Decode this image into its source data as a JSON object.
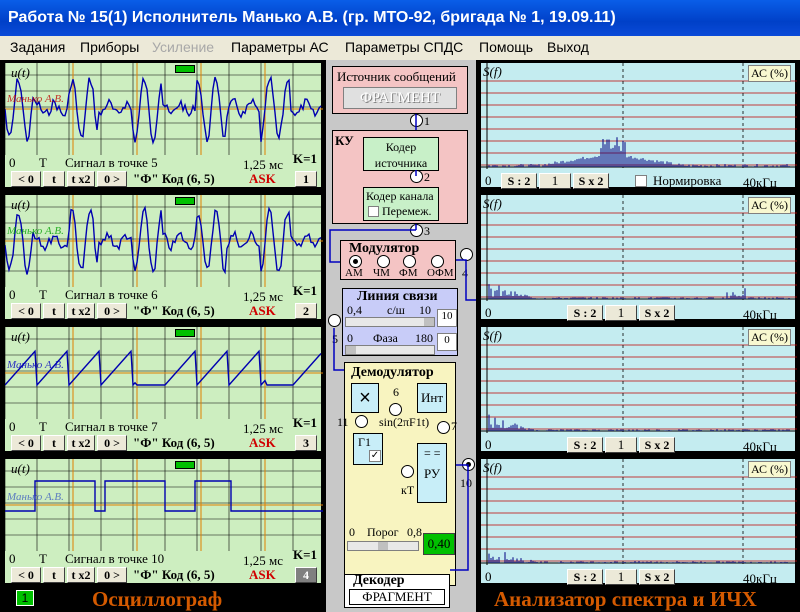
{
  "window_title": "Работа № 15(1)  Исполнитель Манько А.В. (гр. МТО-92, бригада № 1, 19.09.11)",
  "menu": [
    "Задания",
    "Приборы",
    "Усиление",
    "Параметры АС",
    "Параметры СПДС",
    "Помощь",
    "Выход"
  ],
  "osc": {
    "ut_label": "u(t)",
    "watermark": "Манько А.В.",
    "zero": "0",
    "T": "T",
    "time": "1,25 мс",
    "k": "K=1",
    "mod": "ASK",
    "btn_lt0": "< 0",
    "btn_t": "t",
    "btn_tx2": "t x2",
    "btn_gt0": "0 >",
    "code_text": "\"Ф\" Код (6, 5)",
    "channels": [
      {
        "label": "Сигнал в точке 5",
        "btn": "1"
      },
      {
        "label": "Сигнал в точке 6",
        "btn": "2"
      },
      {
        "label": "Сигнал в точке 7",
        "btn": "3"
      },
      {
        "label": "Сигнал в точке 10",
        "btn": "4"
      }
    ],
    "status_num": "1",
    "title": "Осциллограф"
  },
  "center": {
    "source_title": "Источник сообщений",
    "source_value": "ФРАГМЕНТ",
    "ku": "КУ",
    "coder_src": "Кодер источника",
    "coder_ch": "Кодер канала",
    "interleave": "Перемеж.",
    "modulator": "Модулятор",
    "mods": [
      "АМ",
      "ЧМ",
      "ФМ",
      "ОФМ"
    ],
    "line_title": "Линия связи",
    "snr_min": "0,4",
    "snr_unit": "с/ш",
    "snr_max": "10",
    "snr_value": "10",
    "phase_min": "0",
    "phase_unit": "Фаза",
    "phase_max": "180",
    "phase_value": "0",
    "demod": "Демодулятор",
    "mult": "×",
    "integ": "Инт",
    "sin": "sin(2πF1t)",
    "g1": "Г1",
    "ru": "РУ",
    "kt": "кТ",
    "threshold_min": "0",
    "threshold_label": "Порог",
    "threshold_max": "0,8",
    "threshold_value": "0,40",
    "decoder": "Декодер",
    "decoder_value": "ФРАГМЕНТ",
    "points": [
      "1",
      "2",
      "3",
      "4",
      "5",
      "6",
      "7",
      "10",
      "11"
    ]
  },
  "spec": {
    "sf": "S(f)",
    "ac": "АС (%)",
    "freq": "40кГц",
    "s2": "S : 2",
    "one": "1",
    "sx2": "S x 2",
    "normalize": "Нормировка",
    "title": "Анализатор спектра и ИЧХ"
  },
  "colors": {
    "osc_bg": "#cdeec0",
    "spec_bg": "#c4ecf0",
    "orange": "#d45a00"
  }
}
